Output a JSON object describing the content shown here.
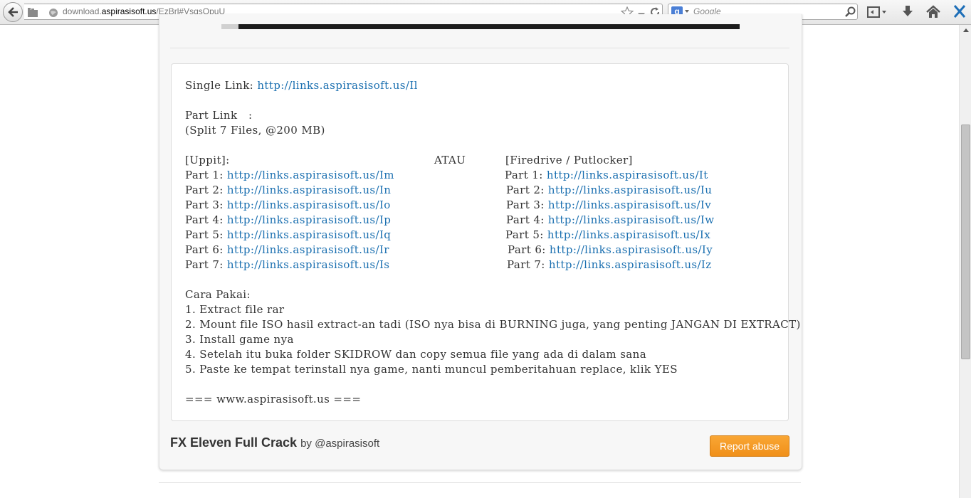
{
  "browser": {
    "url_prefix": "download.",
    "url_domain": "aspirasisoft.us",
    "url_path": "/EzBrl#VsqsOpuU",
    "search_placeholder": "Google",
    "search_engine_letter": "g"
  },
  "post": {
    "single_label": "Single Link: ",
    "single_url": "http://links.aspirasisoft.us/Il",
    "part_link_label": "Part Link   :",
    "split_info": "(Split 7 Files, @200 MB)",
    "uppit_header": "[Uppit]:",
    "or_label": "ATAU",
    "firedrive_header": "[Firedrive / Putlocker]",
    "uppit_parts": [
      {
        "label": "Part 1: ",
        "url": "http://links.aspirasisoft.us/Im"
      },
      {
        "label": "Part 2: ",
        "url": "http://links.aspirasisoft.us/In"
      },
      {
        "label": "Part 3: ",
        "url": "http://links.aspirasisoft.us/Io"
      },
      {
        "label": "Part 4: ",
        "url": "http://links.aspirasisoft.us/Ip"
      },
      {
        "label": "Part 5: ",
        "url": "http://links.aspirasisoft.us/Iq"
      },
      {
        "label": "Part 6: ",
        "url": "http://links.aspirasisoft.us/Ir"
      },
      {
        "label": "Part 7: ",
        "url": "http://links.aspirasisoft.us/Is"
      }
    ],
    "firedrive_parts": [
      {
        "label": "Part 1: ",
        "url": "http://links.aspirasisoft.us/It"
      },
      {
        "label": "Part 2: ",
        "url": "http://links.aspirasisoft.us/Iu"
      },
      {
        "label": "Part 3: ",
        "url": "http://links.aspirasisoft.us/Iv"
      },
      {
        "label": "Part 4: ",
        "url": "http://links.aspirasisoft.us/Iw"
      },
      {
        "label": "Part 5: ",
        "url": "http://links.aspirasisoft.us/Ix"
      },
      {
        "label": "Part 6: ",
        "url": "http://links.aspirasisoft.us/Iy"
      },
      {
        "label": "Part 7: ",
        "url": "http://links.aspirasisoft.us/Iz"
      }
    ],
    "usage_title": "Cara Pakai:",
    "steps": [
      "1. Extract file rar",
      "2. Mount file ISO hasil extract-an tadi (ISO nya bisa di BURNING juga, yang penting JANGAN DI EXTRACT)",
      "3. Install game nya",
      "4. Setelah itu buka folder SKIDROW dan copy semua file yang ada di dalam sana",
      "5. Paste ke tempat terinstall nya game, nanti muncul pemberitahuan replace, klik YES"
    ],
    "signature": "=== www.aspirasisoft.us ==="
  },
  "footer": {
    "title": "FX Eleven Full Crack",
    "by": "by @aspirasisoft",
    "report_label": "Report abuse"
  },
  "colors": {
    "link": "#1a6fb0",
    "report_button": "#f39a24",
    "text": "#333333"
  }
}
